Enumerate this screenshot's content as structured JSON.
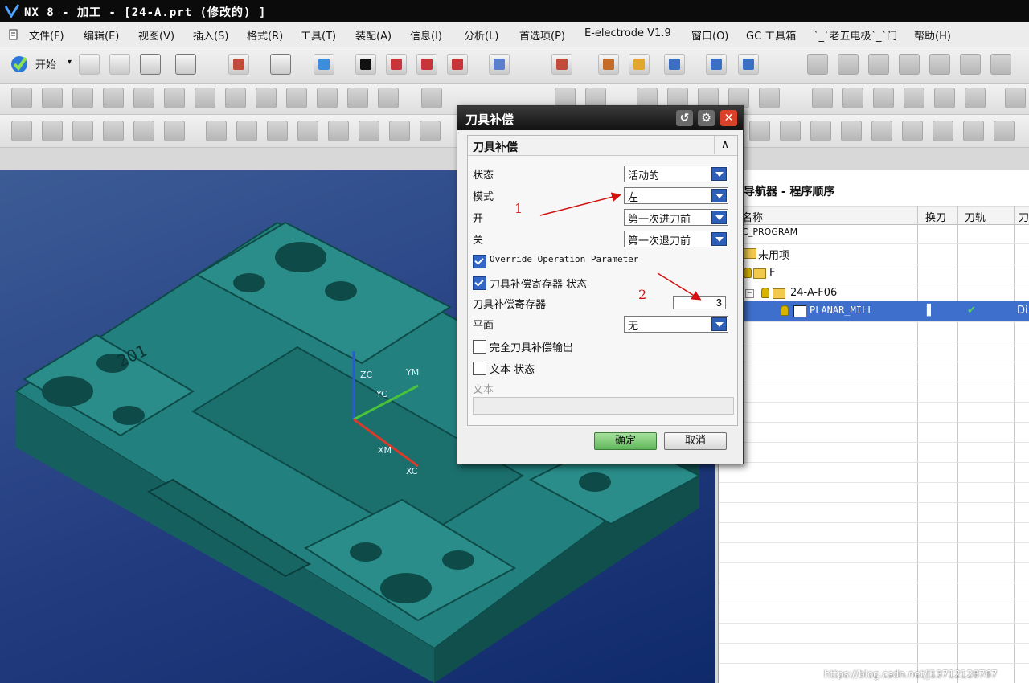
{
  "window": {
    "title": "NX 8 - 加工 - [24-A.prt  (修改的) ]"
  },
  "menu": [
    "文件(F)",
    "编辑(E)",
    "视图(V)",
    "插入(S)",
    "格式(R)",
    "工具(T)",
    "装配(A)",
    "信息(I)",
    "分析(L)",
    "首选项(P)",
    "E-electrode V1.9",
    "窗口(O)",
    "GC 工具箱",
    "`_`老五电极`_`门",
    "帮助(H)"
  ],
  "toolbar": {
    "start_label": "开始"
  },
  "navigator": {
    "title": "导航器 - 程序顺序",
    "columns": [
      "名称",
      "换刀",
      "刀轨",
      "刀"
    ],
    "rows": [
      {
        "label": "NC_PROGRAM",
        "selected": false
      },
      {
        "label": "未用项",
        "selected": false
      },
      {
        "label": "F",
        "selected": false
      },
      {
        "label": "24-A-F06",
        "selected": false
      },
      {
        "label": "PLANAR_MILL",
        "selected": true,
        "tool_change": "▌",
        "path_status": "✔",
        "tool": "Di"
      }
    ]
  },
  "viewport": {
    "axis_labels": [
      "ZC",
      "YM",
      "YC",
      "XM",
      "XC"
    ],
    "part_text": "201"
  },
  "dialog": {
    "title": "刀具补偿",
    "section": "刀具补偿",
    "fields": {
      "status_label": "状态",
      "status_value": "活动的",
      "mode_label": "模式",
      "mode_value": "左",
      "open_label": "开",
      "open_value": "第一次进刀前",
      "close_label": "关",
      "close_value": "第一次退刀前",
      "override_label": "Override Operation Parameter",
      "register_status_label": "刀具补偿寄存器 状态",
      "register_label": "刀具补偿寄存器",
      "register_value": "3",
      "plane_label": "平面",
      "plane_value": "无",
      "full_output_label": "完全刀具补偿输出",
      "text_status_label": "文本 状态",
      "text_label": "文本"
    },
    "checks": {
      "override": true,
      "register_status": true,
      "full_output": false,
      "text_status": false
    },
    "ok_label": "确定",
    "cancel_label": "取消"
  },
  "annotations": [
    "1",
    "2"
  ],
  "watermark": "https://blog.csdn.net/j13712128767",
  "colors": {
    "part": "#1f7a78",
    "selection": "#3f6fcd",
    "annotation": "#d21010"
  }
}
